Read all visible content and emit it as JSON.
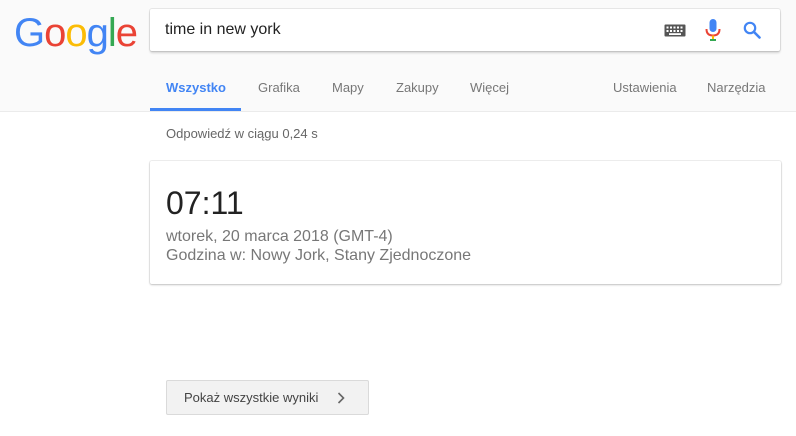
{
  "logo": {
    "letters": [
      "G",
      "o",
      "o",
      "g",
      "l",
      "e"
    ],
    "colors": [
      "#4285f4",
      "#ea4335",
      "#fbbc05",
      "#4285f4",
      "#34a853",
      "#ea4335"
    ]
  },
  "search": {
    "query": "time in new york"
  },
  "icons": {
    "keyboard": "keyboard-icon",
    "mic": "mic-icon",
    "search": "search-icon"
  },
  "tabs": [
    {
      "label": "Wszystko",
      "active": true
    },
    {
      "label": "Grafika"
    },
    {
      "label": "Mapy"
    },
    {
      "label": "Zakupy"
    },
    {
      "label": "Więcej"
    },
    {
      "label": "Ustawienia"
    },
    {
      "label": "Narzędzia"
    }
  ],
  "accent_color": "#4285f4",
  "stats": "Odpowiedź w ciągu 0,24 s",
  "time_card": {
    "time": "07:11",
    "date": "wtorek, 20 marca 2018 (GMT-4)",
    "place": "Godzina w: Nowy Jork, Stany Zjednoczone"
  },
  "show_all_button": {
    "label": "Pokaż wszystkie wyniki"
  }
}
